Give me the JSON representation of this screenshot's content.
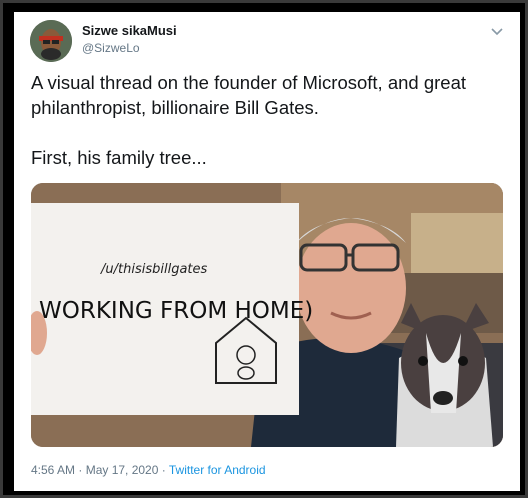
{
  "author": {
    "display_name": "Sizwe sikaMusi",
    "handle": "@SizweLo"
  },
  "tweet": {
    "line1": "A visual thread on the founder of Microsoft, and great philanthropist, billionaire Bill Gates.",
    "line2": "First, his family tree..."
  },
  "image": {
    "sign_small_text": "/u/thisisbillgates",
    "sign_big_text": "WORKING FROM HOME)"
  },
  "meta": {
    "timestamp": "4:56 AM · May 17, 2020",
    "separator": " · ",
    "source": "Twitter for Android"
  },
  "colors": {
    "link": "#1b95e0",
    "secondary_text": "#657786",
    "primary_text": "#14171a"
  },
  "icons": [
    "chevron-down-icon"
  ]
}
